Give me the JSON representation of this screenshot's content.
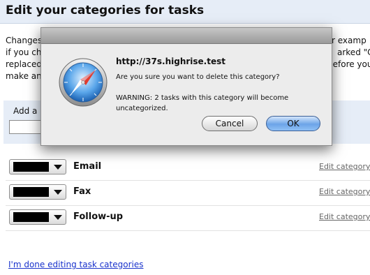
{
  "page": {
    "title": "Edit your categories for tasks",
    "intro_lines": [
      "Changes",
      "if you ch",
      "replaced",
      "make an"
    ],
    "intro_right_fragments": [
      "r examp",
      "arked \"Ca",
      "before you"
    ]
  },
  "add_category": {
    "label": "Add a",
    "input_value": ""
  },
  "categories": [
    {
      "name": "Email",
      "color": "#000000",
      "edit_label": "Edit category"
    },
    {
      "name": "Fax",
      "color": "#000000",
      "edit_label": "Edit category"
    },
    {
      "name": "Follow-up",
      "color": "#000000",
      "edit_label": "Edit category"
    }
  ],
  "done_link": "I'm done editing task categories",
  "dialog": {
    "host": "http://37s.highrise.test",
    "question": "Are you sure you want to delete this category?",
    "warning": "WARNING: 2 tasks with this category will become uncategorized.",
    "cancel_label": "Cancel",
    "ok_label": "OK",
    "icon": "safari-compass-icon"
  },
  "colors": {
    "header_bg": "#e6edf7",
    "link": "#1a33cc",
    "ok_button": "#6ca4e8"
  }
}
